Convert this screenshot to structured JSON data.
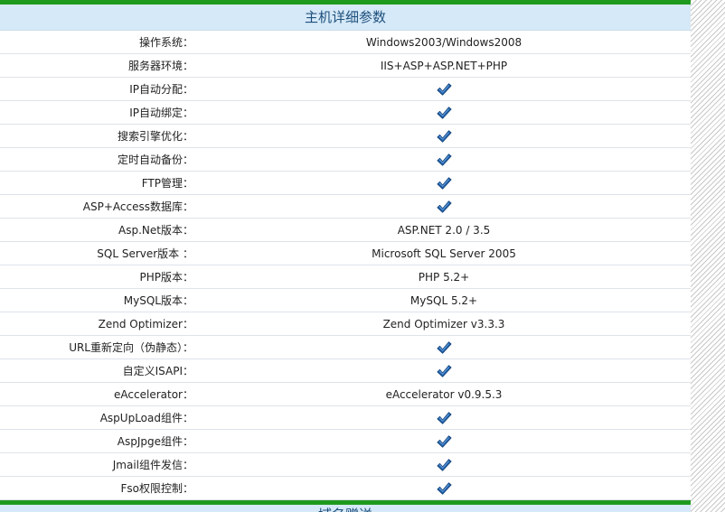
{
  "header": {
    "title": "主机详细参数"
  },
  "colors": {
    "accent_bar": "#1f9a1f",
    "header_bg": "#d6e9f8",
    "header_text": "#1d4f7c",
    "check": "#1f5fa8"
  },
  "rows": [
    {
      "label": "操作系统：",
      "value": "Windows2003/Windows2008"
    },
    {
      "label": "服务器环境：",
      "value": "IIS+ASP+ASP.NET+PHP"
    },
    {
      "label": "IP自动分配：",
      "value": null,
      "icon": "check-icon"
    },
    {
      "label": "IP自动绑定：",
      "value": null,
      "icon": "check-icon"
    },
    {
      "label": "搜索引擎优化：",
      "value": null,
      "icon": "check-icon"
    },
    {
      "label": "定时自动备份：",
      "value": null,
      "icon": "check-icon"
    },
    {
      "label": "FTP管理：",
      "value": null,
      "icon": "check-icon"
    },
    {
      "label": "ASP+Access数据库：",
      "value": null,
      "icon": "check-icon"
    },
    {
      "label": "Asp.Net版本：",
      "value": "ASP.NET 2.0 / 3.5"
    },
    {
      "label": "SQL Server版本 ：",
      "value": "Microsoft SQL Server 2005"
    },
    {
      "label": "PHP版本：",
      "value": "PHP 5.2+"
    },
    {
      "label": "MySQL版本：",
      "value": "MySQL 5.2+"
    },
    {
      "label": "Zend Optimizer：",
      "value": "Zend Optimizer v3.3.3"
    },
    {
      "label": "URL重新定向（伪静态）：",
      "value": null,
      "icon": "check-icon"
    },
    {
      "label": "自定义ISAPI：",
      "value": null,
      "icon": "check-icon"
    },
    {
      "label": "eAccelerator：",
      "value": "eAccelerator v0.9.5.3"
    },
    {
      "label": "AspUpLoad组件：",
      "value": null,
      "icon": "check-icon"
    },
    {
      "label": "AspJpge组件：",
      "value": null,
      "icon": "check-icon"
    },
    {
      "label": "Jmail组件发信：",
      "value": null,
      "icon": "check-icon"
    },
    {
      "label": "Fso权限控制：",
      "value": null,
      "icon": "check-icon"
    }
  ],
  "next_section": {
    "title": "域名赠送"
  }
}
